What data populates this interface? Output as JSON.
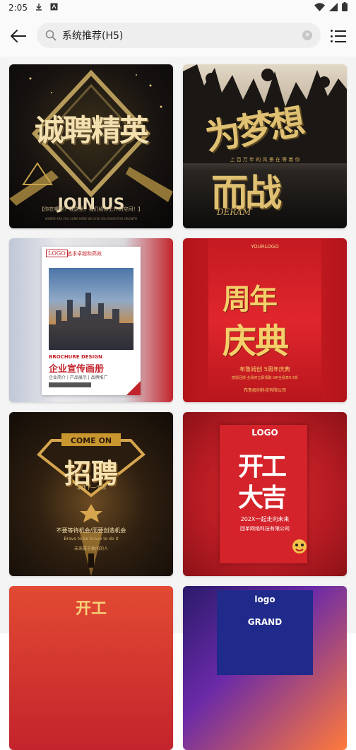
{
  "status_bar": {
    "time": "2:05"
  },
  "search": {
    "query": "系统推荐(H5)"
  },
  "templates": [
    {
      "title": "诚聘精英",
      "headline": "JOIN US",
      "tagline": "【你在哪里？我这里，我们给你上升的空间！】",
      "footer": "WHERE ARE YOU COME HERE WE GIVE YOU ROOM FOR GROWTH"
    },
    {
      "title_a": "为梦想",
      "title_b": "而战",
      "subtitle": "上 百 万 年 的 风 景 在 等 着 你",
      "latin": "DERAM"
    },
    {
      "logo": "LOGO",
      "tagline": "追求卓越和高效",
      "label": "BROCHURE DESIGN",
      "title": "企业宣传画册",
      "subtitle": "企业简介 | 产品展示 | 品牌推广"
    },
    {
      "logo": "YOURLOGO",
      "title_a": "周年",
      "title_b": "庆典",
      "line1": "布鲁姆创 5周年庆典",
      "line2": "感恩回馈 全场买立即领取 VIP全场享9.5折",
      "line3": "布鲁姆创科技有限公司"
    },
    {
      "banner": "COME ON",
      "title": "招聘",
      "subtitle": "寻找下一个你",
      "line1": "不要等待机会/而要创造机会",
      "line2": "Brave to be brave to do it",
      "line3": "未来属于敢闯的人"
    },
    {
      "logo": "LOGO",
      "title_a": "开工",
      "title_b": "大吉",
      "line1": "202X一起走向未来",
      "line2": "回单网络科技有限公司"
    },
    {
      "title": "开工"
    },
    {
      "logo": "logo",
      "title": "GRAND"
    }
  ]
}
